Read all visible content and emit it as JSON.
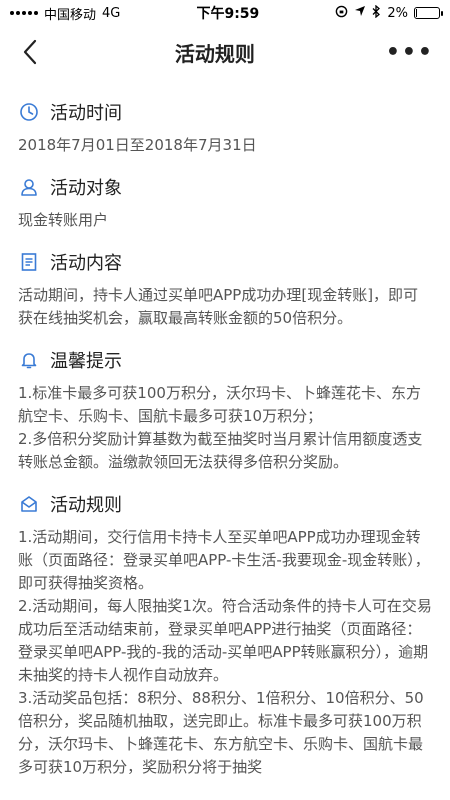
{
  "status_bar": {
    "carrier": "中国移动",
    "network": "4G",
    "time": "下午9:59",
    "battery": "2%",
    "battery_level": 0.02
  },
  "nav": {
    "title": "活动规则",
    "more": "•••"
  },
  "sections": [
    {
      "title": "活动时间",
      "icon": "clock-icon",
      "lines": [
        "2018年7月01日至2018年7月31日"
      ]
    },
    {
      "title": "活动对象",
      "icon": "user-icon",
      "lines": [
        "现金转账用户"
      ]
    },
    {
      "title": "活动内容",
      "icon": "document-icon",
      "lines": [
        "活动期间，持卡人通过买单吧APP成功办理[现金转账]，即可获在线抽奖机会，赢取最高转账金额的50倍积分。"
      ]
    },
    {
      "title": "温馨提示",
      "icon": "bell-icon",
      "lines": [
        "1.标准卡最多可获100万积分，沃尔玛卡、卜蜂莲花卡、东方航空卡、乐购卡、国航卡最多可获10万积分；",
        "2.多倍积分奖励计算基数为截至抽奖时当月累计信用额度透支转账总金额。溢缴款领回无法获得多倍积分奖励。"
      ]
    },
    {
      "title": "活动规则",
      "icon": "envelope-icon",
      "lines": [
        "1.活动期间，交行信用卡持卡人至买单吧APP成功办理现金转账（页面路径：登录买单吧APP-卡生活-我要现金-现金转账），即可获得抽奖资格。",
        "2.活动期间，每人限抽奖1次。符合活动条件的持卡人可在交易成功后至活动结束前，登录买单吧APP进行抽奖（页面路径：登录买单吧APP-我的-我的活动-买单吧APP转账赢积分），逾期未抽奖的持卡人视作自动放弃。",
        "3.活动奖品包括：8积分、88积分、1倍积分、10倍积分、50倍积分，奖品随机抽取，送完即止。标准卡最多可获100万积分，沃尔玛卡、卜蜂莲花卡、东方航空卡、乐购卡、国航卡最多可获10万积分，奖励积分将于抽奖"
      ]
    }
  ],
  "colors": {
    "icon": "#3a7bd5",
    "text": "#555555",
    "title": "#222222"
  }
}
